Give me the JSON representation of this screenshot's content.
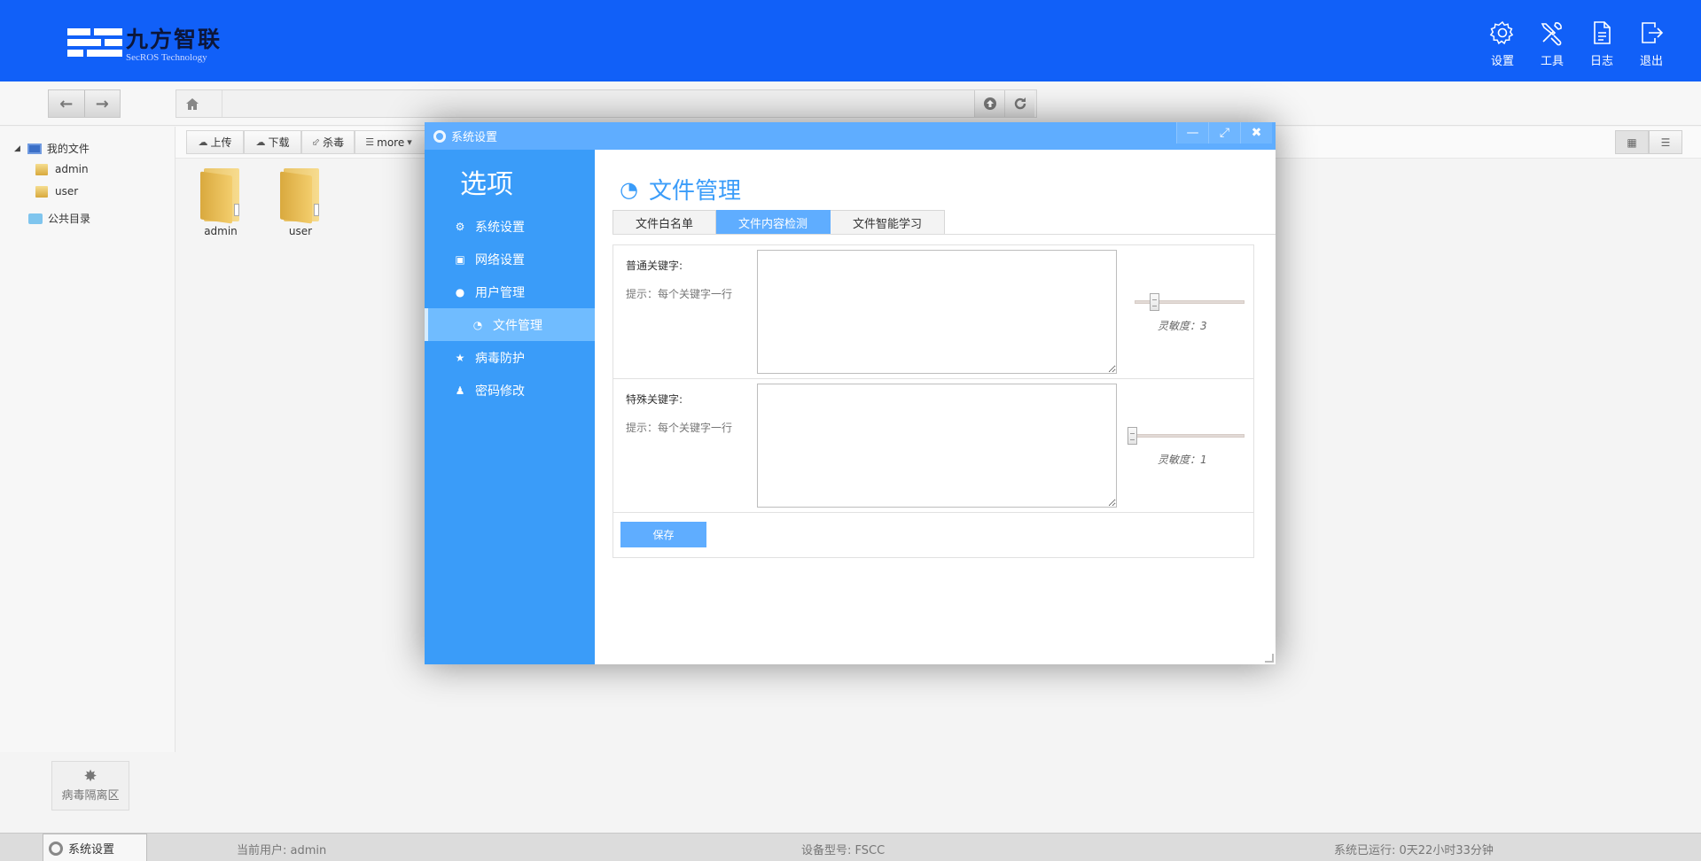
{
  "header": {
    "logo_cn": "九方智联",
    "logo_en": "SecROS Technology",
    "actions": [
      {
        "label": "设置",
        "icon": "gear-icon"
      },
      {
        "label": "工具",
        "icon": "tools-icon"
      },
      {
        "label": "日志",
        "icon": "document-icon"
      },
      {
        "label": "退出",
        "icon": "exit-icon"
      }
    ]
  },
  "tree": {
    "root": "我的文件",
    "children": [
      "admin",
      "user"
    ],
    "public": "公共目录",
    "quarantine": "病毒隔离区"
  },
  "toolbar": {
    "upload": "上传",
    "download": "下载",
    "antivirus": "杀毒",
    "more": "more"
  },
  "files": [
    {
      "name": "admin"
    },
    {
      "name": "user"
    }
  ],
  "dialog": {
    "title": "系统设置",
    "side_title": "选项",
    "menu": [
      {
        "label": "系统设置",
        "icon": "gear-icon"
      },
      {
        "label": "网络设置",
        "icon": "image-icon"
      },
      {
        "label": "用户管理",
        "icon": "users-icon"
      },
      {
        "label": "文件管理",
        "icon": "dashboard-icon"
      },
      {
        "label": "病毒防护",
        "icon": "star-icon"
      },
      {
        "label": "密码修改",
        "icon": "user-icon"
      }
    ],
    "active_menu": "文件管理",
    "main_title": "文件管理",
    "tabs": [
      "文件白名单",
      "文件内容检测",
      "文件智能学习"
    ],
    "active_tab": "文件内容检测",
    "rows": [
      {
        "label": "普通关键字:",
        "hint": "提示：每个关键字一行",
        "value": "",
        "sensitivity_text": "灵敏度：3",
        "sensitivity": 3
      },
      {
        "label": "特殊关键字:",
        "hint": "提示：每个关键字一行",
        "value": "",
        "sensitivity_text": "灵敏度：1",
        "sensitivity": 1
      }
    ],
    "save_label": "保存"
  },
  "status": {
    "start_label": "系统设置",
    "user": "当前用户: admin",
    "device": "设备型号: FSCC",
    "uptime": "系统已运行: 0天22小时33分钟"
  },
  "colors": {
    "header": "#1160f8",
    "accent": "#3a9cf9",
    "accent_light": "#5fadff"
  }
}
